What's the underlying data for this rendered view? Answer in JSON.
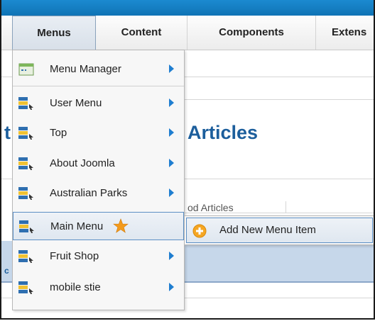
{
  "menubar": {
    "items": [
      {
        "label": "Menus"
      },
      {
        "label": "Content"
      },
      {
        "label": "Components"
      },
      {
        "label": "Extens"
      }
    ]
  },
  "dropdown": {
    "items": [
      {
        "label": "Menu Manager",
        "icon": "menu-manager-icon",
        "has_submenu": true
      },
      {
        "label": "User Menu",
        "icon": "menu-icon",
        "has_submenu": true
      },
      {
        "label": "Top",
        "icon": "menu-icon",
        "has_submenu": true
      },
      {
        "label": "About Joomla",
        "icon": "menu-icon",
        "has_submenu": true
      },
      {
        "label": "Australian Parks",
        "icon": "menu-icon",
        "has_submenu": true
      },
      {
        "label": "Main Menu",
        "icon": "menu-icon",
        "has_submenu": false,
        "home_star": true,
        "highlighted": true
      },
      {
        "label": "Fruit Shop",
        "icon": "menu-icon",
        "has_submenu": true
      },
      {
        "label": "mobile stie",
        "icon": "menu-icon",
        "has_submenu": true
      }
    ]
  },
  "submenu": {
    "item": {
      "label": "Add New Menu Item",
      "icon": "add-circle-icon"
    }
  },
  "background": {
    "title_fragment": "t",
    "title": "Articles",
    "subtab": "od Articles",
    "band_fragment": "c"
  },
  "colors": {
    "accent": "#1f7ed0",
    "highlight_border": "#5c8fc4",
    "title": "#1c5e9c",
    "star": "#f39a1c"
  }
}
